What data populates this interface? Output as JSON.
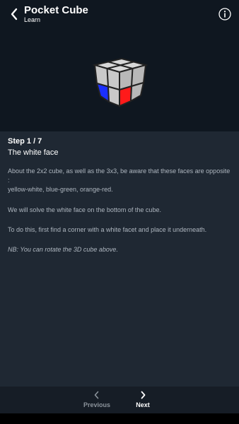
{
  "header": {
    "title": "Pocket Cube",
    "subtitle": "Learn",
    "back_icon": "chevron-left-icon",
    "info_icon": "info-icon"
  },
  "cube": {
    "icon": "2x2-cube-3d-view",
    "colors": {
      "top": "#d8d8d8",
      "left_upper": "#c9c9c9",
      "right_upper": "#b8b8b8",
      "left_lower_inner": "#c9c9c9",
      "left_lower_outer": "#1a2fff",
      "right_lower_inner": "#ff1a1a",
      "right_lower_outer": "#b8b8b8",
      "border": "#222222"
    }
  },
  "lesson": {
    "step_label": "Step 1 / 7",
    "step_title": "The white face",
    "paragraph_1_line_1": "About the 2x2 cube, as well as the 3x3, be aware that these faces are opposite :",
    "paragraph_1_line_2": "yellow-white, blue-green, orange-red.",
    "paragraph_2": "We will solve the white face on the bottom of the cube.",
    "paragraph_3": "To do this, first find a corner with a white facet and place it underneath.",
    "paragraph_4": "NB: You can rotate the 3D cube above."
  },
  "nav": {
    "previous_label": "Previous",
    "next_label": "Next",
    "previous_icon": "chevron-left-icon",
    "next_icon": "chevron-right-icon"
  },
  "colors": {
    "background_top": "#0f1720",
    "content_background": "#1f2833",
    "text_primary": "#ffffff",
    "text_secondary": "#aeb6bf",
    "nav_background": "#161d26",
    "nav_disabled": "#8b939b"
  }
}
